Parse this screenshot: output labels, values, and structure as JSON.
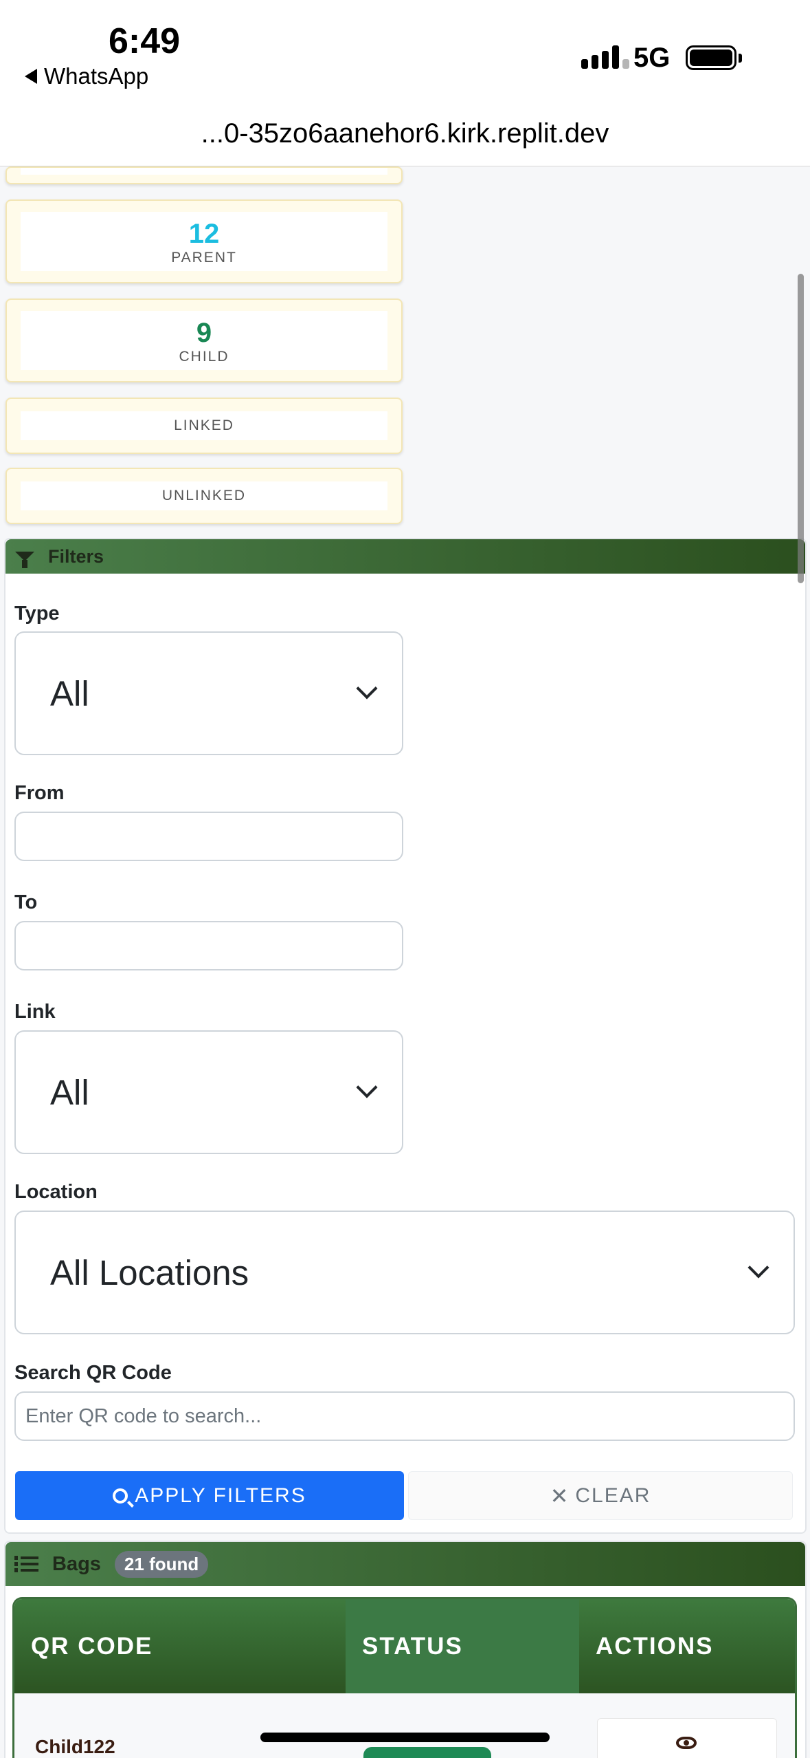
{
  "status_bar": {
    "time": "6:49",
    "back_app": "WhatsApp",
    "network": "5G"
  },
  "browser": {
    "url": "...0-35zo6aanehor6.kirk.replit.dev"
  },
  "stats": [
    {
      "value": "12",
      "label": "PARENT",
      "color": "#1bbde0"
    },
    {
      "value": "9",
      "label": "CHILD",
      "color": "#198754"
    },
    {
      "value": "",
      "label": "LINKED"
    },
    {
      "value": "",
      "label": "UNLINKED"
    }
  ],
  "filters": {
    "title": "Filters",
    "type_label": "Type",
    "type_value": "All",
    "from_label": "From",
    "from_value": "",
    "to_label": "To",
    "to_value": "",
    "link_label": "Link",
    "link_value": "All",
    "location_label": "Location",
    "location_value": "All Locations",
    "search_label": "Search QR Code",
    "search_placeholder": "Enter QR code to search...",
    "apply_label": "APPLY FILTERS",
    "clear_label": "CLEAR"
  },
  "bags": {
    "title": "Bags",
    "count_badge": "21 found",
    "columns": [
      "QR CODE",
      "STATUS",
      "ACTIONS"
    ],
    "rows": [
      {
        "qr_code": "Child122"
      }
    ]
  },
  "colors": {
    "accent_blue": "#1a6ef7",
    "header_green": "#2b4f1e",
    "parent": "#1bbde0",
    "child": "#198754"
  }
}
